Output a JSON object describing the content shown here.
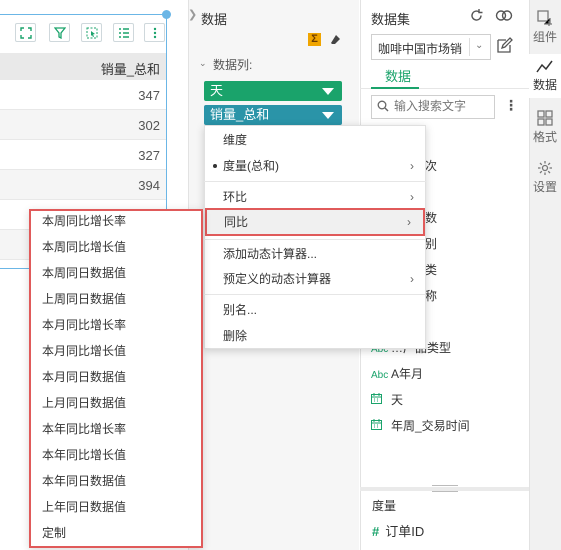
{
  "table": {
    "header": "销量_总和",
    "rows": [
      "347",
      "302",
      "327",
      "394"
    ]
  },
  "data_panel": {
    "title": "数据",
    "sigma_icon": "Σ",
    "columns_label": "数据列:",
    "pills": [
      {
        "label": "天",
        "color": "#1aa36b"
      },
      {
        "label": "销量_总和",
        "color": "#2a94a8"
      }
    ]
  },
  "dataset_panel": {
    "title": "数据集",
    "selected_dataset": "咖啡中国市场销",
    "tab": "数据",
    "search_placeholder": "输入搜索文字",
    "partial_fields": [
      "次",
      "数",
      "别",
      "类",
      "称"
    ],
    "fields": [
      {
        "label": "…产品类型",
        "icon": "abc"
      },
      {
        "label": "A年月",
        "icon": "abc"
      },
      {
        "label": "天",
        "icon": "calendar"
      },
      {
        "label": "年周_交易时间",
        "icon": "calendar"
      }
    ],
    "field_icon_text": "Abc",
    "measure_label": "度量",
    "measure_field": "订单ID",
    "measure_hash": "#"
  },
  "right_tabs": [
    {
      "label": "组件"
    },
    {
      "label": "数据"
    },
    {
      "label": "格式"
    },
    {
      "label": "设置"
    }
  ],
  "context_menu": {
    "items": [
      "维度",
      "度量(总和)",
      "环比",
      "同比",
      "添加动态计算器...",
      "预定义的动态计算器",
      "别名...",
      "删除"
    ]
  },
  "submenu": {
    "items": [
      "本周同比增长率",
      "本周同比增长值",
      "本周同日数据值",
      "上周同日数据值",
      "本月同比增长率",
      "本月同比增长值",
      "本月同日数据值",
      "上月同日数据值",
      "本年同比增长率",
      "本年同比增长值",
      "本年同日数据值",
      "上年同日数据值",
      "定制"
    ]
  },
  "colors": {
    "accent": "#1aa36b",
    "teal": "#2a94a8",
    "highlight_border": "#e05a5a"
  }
}
